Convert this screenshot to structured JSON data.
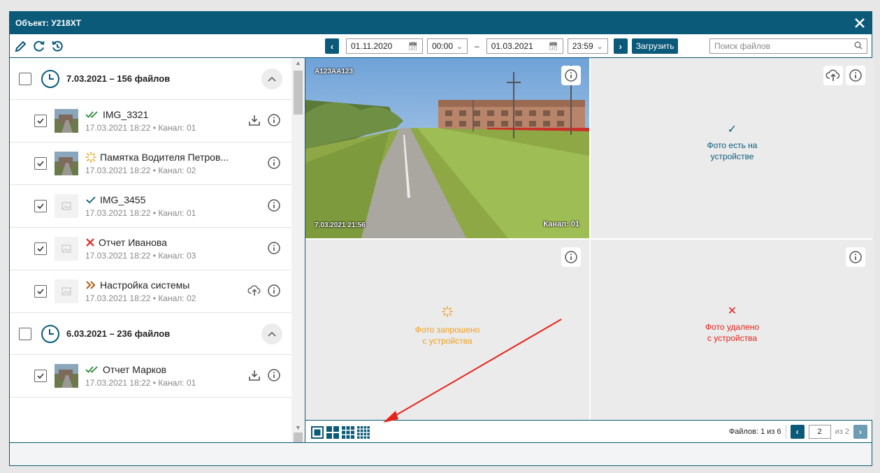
{
  "window": {
    "title": "Объект: У218ХТ"
  },
  "toolbar": {
    "date_from": "01.11.2020",
    "time_from": "00:00",
    "dash": "–",
    "date_to": "01.03.2021",
    "time_to": "23:59",
    "load_label": "Загрузить",
    "search_placeholder": "Поиск файлов"
  },
  "groups": [
    {
      "title": "7.03.2021 – 156 файлов",
      "items": [
        {
          "name": "IMG_3321",
          "status": "double-check",
          "date": "17.03.2021 18:22",
          "channel": "Канал: 01",
          "has_photo": true,
          "actions": [
            "download",
            "info"
          ]
        },
        {
          "name": "Памятка Водителя Петров...",
          "status": "loading",
          "date": "17.03.2021 18:22",
          "channel": "Канал: 02",
          "has_photo": true,
          "actions": [
            "info"
          ]
        },
        {
          "name": "IMG_3455",
          "status": "check",
          "date": "17.03.2021 18:22",
          "channel": "Канал: 01",
          "has_photo": false,
          "actions": [
            "info"
          ]
        },
        {
          "name": "Отчет Иванова",
          "status": "deleted",
          "date": "17.03.2021 18:22",
          "channel": "Канал: 03",
          "has_photo": false,
          "actions": [
            "info"
          ]
        },
        {
          "name": "Настройка системы",
          "status": "forward",
          "date": "17.03.2021 18:22",
          "channel": "Канал: 02",
          "has_photo": false,
          "actions": [
            "upload",
            "info"
          ]
        }
      ]
    },
    {
      "title": "6.03.2021 – 236 файлов",
      "items": [
        {
          "name": "Отчет Марков",
          "status": "double-check",
          "date": "17.03.2021 18:22",
          "channel": "Канал: 01",
          "has_photo": true,
          "actions": [
            "download",
            "info"
          ]
        }
      ]
    }
  ],
  "dot": "•",
  "cells": {
    "photo": {
      "plate": "А123АА123",
      "timestamp": "7.03.2021 21:56",
      "channel": "Канал: 01"
    },
    "on_device": {
      "text1": "Фото есть на",
      "text2": "устройстве"
    },
    "requested": {
      "text1": "Фото запрошено",
      "text2": "с устройства"
    },
    "deleted": {
      "text1": "Фото удалено",
      "text2": "с устройства"
    }
  },
  "pager": {
    "files_label": "Файлов: 1 из 6",
    "page": "2",
    "of_label": "из 2"
  },
  "colors": {
    "primary": "#0b5a7a",
    "green": "#2e8b3a",
    "orange": "#f0a020",
    "red": "#e8231b",
    "brown": "#b5651d"
  }
}
